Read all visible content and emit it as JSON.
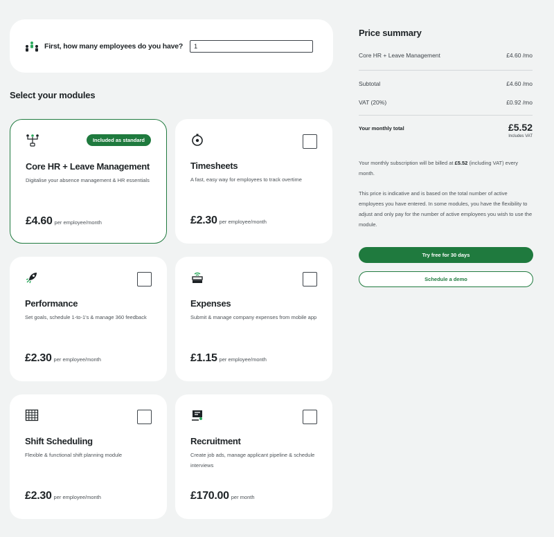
{
  "employees": {
    "question": "First, how many employees do you have?",
    "value": "1",
    "icon": "people-icon"
  },
  "modules_title": "Select your modules",
  "modules": [
    {
      "name": "Core HR + Leave Management",
      "description": "Digitalise your absence management & HR essentials",
      "price": "£4.60",
      "unit": "per employee/month",
      "badge": "Included as standard",
      "icon": "people-network-icon",
      "selected": true
    },
    {
      "name": "Timesheets",
      "description": "A fast, easy way for employees to track overtime",
      "price": "£2.30",
      "unit": "per employee/month",
      "icon": "stopwatch-icon",
      "selected": false
    },
    {
      "name": "Performance",
      "description": "Set goals, schedule 1-to-1's & manage 360 feedback",
      "price": "£2.30",
      "unit": "per employee/month",
      "icon": "rocket-icon",
      "selected": false
    },
    {
      "name": "Expenses",
      "description": "Submit & manage company expenses from mobile app",
      "price": "£1.15",
      "unit": "per employee/month",
      "icon": "receipt-icon",
      "selected": false
    },
    {
      "name": "Shift Scheduling",
      "description": "Flexible & functional shift planning module",
      "price": "£2.30",
      "unit": "per employee/month",
      "icon": "calendar-grid-icon",
      "selected": false
    },
    {
      "name": "Recruitment",
      "description": "Create job ads, manage applicant pipeline & schedule interviews",
      "price": "£170.00",
      "unit": "per month",
      "icon": "job-board-icon",
      "selected": false
    }
  ],
  "summary": {
    "title": "Price summary",
    "line_item": {
      "label": "Core HR + Leave Management",
      "value": "£4.60 /mo"
    },
    "subtotal": {
      "label": "Subtotal",
      "value": "£4.60 /mo"
    },
    "vat": {
      "label": "VAT (20%)",
      "value": "£0.92 /mo"
    },
    "total": {
      "label": "Your monthly total",
      "value": "£5.52",
      "note": "Includes VAT"
    },
    "billing_before": "Your monthly subscription will be billed at",
    "billing_amount": "£5.52",
    "billing_after": "(including VAT) every month.",
    "disclaimer": "This price is indicative and is based on the total number of active employees you have entered. In some modules, you have the flexibility to adjust and only pay for the number of active employees you wish to use the module.",
    "primary_button": "Try free for 30 days",
    "secondary_button": "Schedule a demo"
  },
  "colors": {
    "brand_green": "#1f7a3e",
    "background": "#f1f3f3",
    "card": "#ffffff"
  }
}
